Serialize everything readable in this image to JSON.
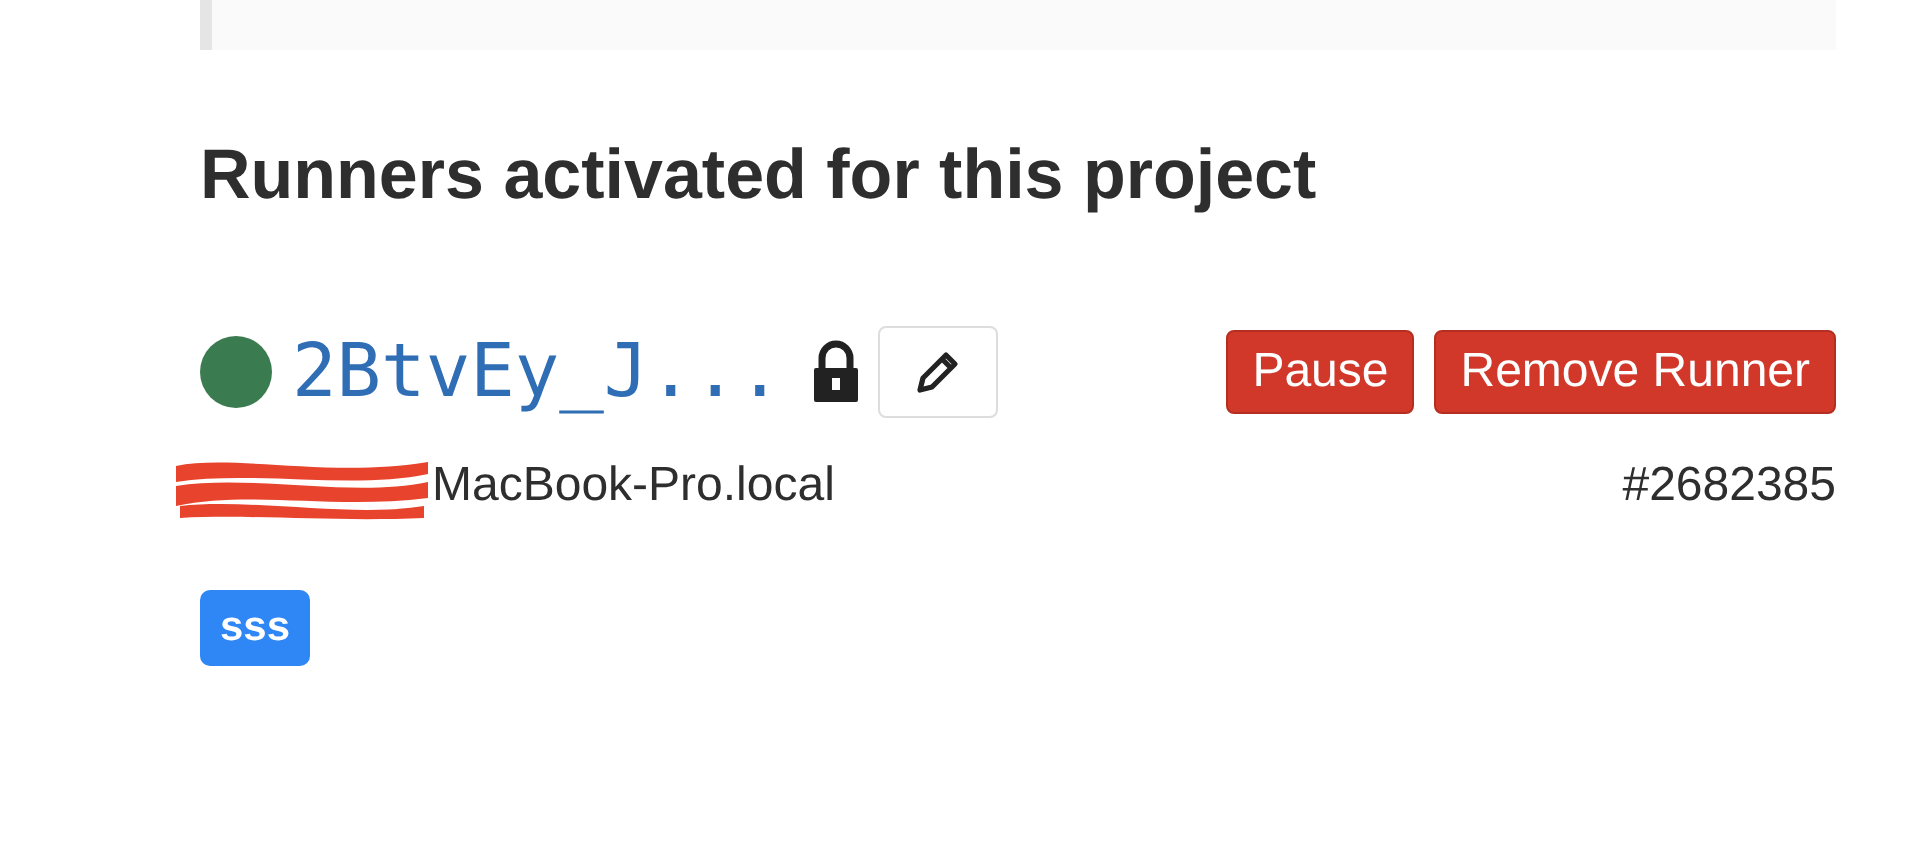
{
  "heading": "Runners activated for this project",
  "runner": {
    "color": "#3a7b4f",
    "name": "2BtvEy_J...",
    "locked": true,
    "buttons": [
      "Pause",
      "Remove Runner"
    ],
    "host": "MacBook-Pro.local",
    "host_redacted": true,
    "id": "#2682385",
    "tags": [
      "sss"
    ]
  }
}
